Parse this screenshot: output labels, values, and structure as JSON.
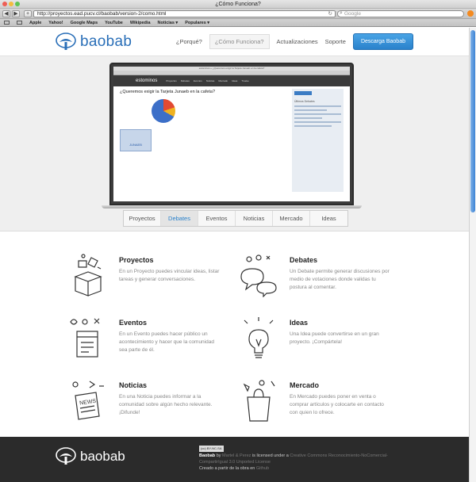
{
  "browser": {
    "window_title": "¿Cómo Funciona?",
    "url": "http://proyectos.ead.pucv.cl/baobab/version-2/como.html",
    "search_placeholder": "Google",
    "back": "◀",
    "forward": "▶",
    "add": "+",
    "bookmarks": [
      "Apple",
      "Yahoo!",
      "Google Maps",
      "YouTube",
      "Wikipedia",
      "Noticias ▾",
      "Populares ▾"
    ]
  },
  "header": {
    "logo_text": "baobab",
    "nav": [
      "¿Porqué?",
      "¿Cómo Funciona?",
      "Actualizaciones",
      "Soporte"
    ],
    "download_label": "Descarga Baobab"
  },
  "hero_screen": {
    "window_title": "estominos » ¿Queremos exigir la Tarjeta Junaeb en la cafeta?",
    "brand": "estominos",
    "menu": [
      "Proyectos",
      "Debates",
      "Eventos",
      "Noticias",
      "Mercado",
      "Ideas",
      "Trueke"
    ],
    "post_title": "¿Queremos exigir la Tarjeta Junaeb en la cafeta?",
    "sidebar_title": "Últimos Debates",
    "image_caption": "JUNAEB"
  },
  "tabs": [
    "Proyectos",
    "Debates",
    "Eventos",
    "Noticias",
    "Mercado",
    "Ideas"
  ],
  "features": [
    {
      "title": "Proyectos",
      "text": "En un Proyecto puedes vincular ideas, listar tareas y generar conversaciones.",
      "icon": "box-icon"
    },
    {
      "title": "Debates",
      "text": "Un Debate permite generar discusiones por medio de votaciones donde validas tu postura al comentar.",
      "icon": "speech-bubbles-icon"
    },
    {
      "title": "Eventos",
      "text": "En un Evento puedes hacer público un acontecimiento y hacer que la comunidad sea parte de él.",
      "icon": "calendar-icon"
    },
    {
      "title": "Ideas",
      "text": "Una Idea puede convertirse en un gran proyecto. ¡Compártela!",
      "icon": "lightbulb-icon"
    },
    {
      "title": "Noticias",
      "text": "En una Noticia puedes informar a la comunidad sobre algún hecho relevante. ¡Difunde!",
      "icon": "newspaper-icon"
    },
    {
      "title": "Mercado",
      "text": "En Mercado puedes poner en venta o comprar artículos y colocarte en contacto con quien lo ofrece.",
      "icon": "shopping-bag-icon"
    }
  ],
  "footer": {
    "logo_text": "baobab",
    "cc_badge": "(cc) BY-NC-SA",
    "license_lead": "Baobab",
    "license_by": "by",
    "authors": "Martel & Perez",
    "license_mid": "is licensed under a",
    "license_name": "Creative Commons Reconocimiento-NoComercial-CompartirIgual 3.0 Unported License",
    "built_on": "Creado a partir de la obra en",
    "source": "Github"
  }
}
